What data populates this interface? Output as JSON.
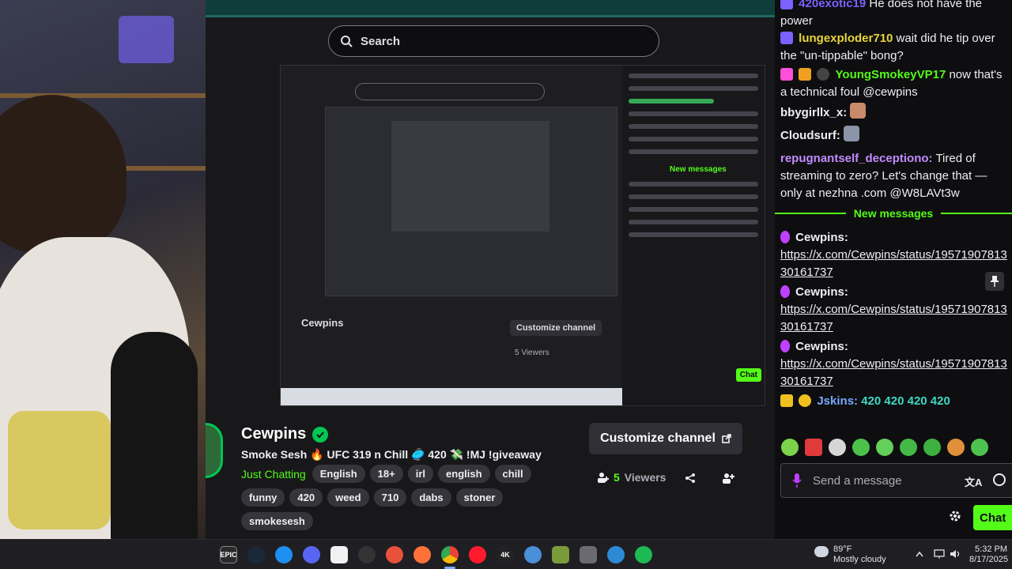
{
  "header": {
    "search_placeholder": "Search"
  },
  "channel": {
    "name": "Cewpins",
    "title": "Smoke Sesh 🔥 UFC 319 n Chill 🥏 420 💸 !MJ !giveaway",
    "category": "Just Chatting",
    "tags_row1": [
      "English",
      "18+",
      "irl",
      "english",
      "chill"
    ],
    "tags_row2": [
      "funny",
      "420",
      "weed",
      "710",
      "dabs",
      "stoner"
    ],
    "tags_row3": [
      "smokesesh"
    ],
    "customize_label": "Customize channel",
    "viewers_count": "5",
    "viewers_label": "Viewers"
  },
  "chat": {
    "messages": [
      {
        "user": "420exotic19",
        "user_color": "#7b61ff",
        "text": "He does not have the power"
      },
      {
        "user": "lungexploder710",
        "user_color": "#e8d53a",
        "text": "wait did he tip over the \"un-tippable\" bong?"
      },
      {
        "user": "YoungSmokeyVP17",
        "user_color": "#53fc18",
        "text": "now that's a technical foul @cewpins"
      },
      {
        "user": "bbygirllx_x:",
        "user_color": "#efeff1",
        "text": ""
      },
      {
        "user": "Cloudsurf:",
        "user_color": "#efeff1",
        "text": ""
      },
      {
        "user": "repugnantself_deceptiono",
        "user_color": "#c38bff",
        "text": "Tired of streaming to zero? Let's change that — only at nezhna .com @W8LAVt3w"
      }
    ],
    "divider_label": "New messages",
    "link_messages": [
      {
        "user": "Cewpins:",
        "user_color": "#efeff1",
        "link": "https://x.com/Cewpins/status/1957190781330161737"
      },
      {
        "user": "Cewpins:",
        "user_color": "#efeff1",
        "link": "https://x.com/Cewpins/status/1957190781330161737"
      },
      {
        "user": "Cewpins:",
        "user_color": "#efeff1",
        "link": "https://x.com/Cewpins/status/1957190781330161737"
      }
    ],
    "emote_user": "Jskins:",
    "emote_user_color": "#7aa7ff",
    "emote_text": "420 420 420 420",
    "input_placeholder": "Send a message",
    "chat_button": "Chat"
  },
  "nested_preview": {
    "channel_name": "Cewpins",
    "customize_label": "Customize channel",
    "viewers_text": "5 Viewers",
    "divider_label": "New messages",
    "chat_button": "Chat"
  },
  "taskbar": {
    "weather_temp": "89°F",
    "weather_desc": "Mostly cloudy",
    "time": "5:32 PM",
    "date": "8/17/2025",
    "icons": [
      "epic-games",
      "steam",
      "app-store",
      "discord",
      "capcut",
      "github",
      "revolut",
      "firefox",
      "chrome",
      "opera",
      "4k-downloader",
      "vpn",
      "minecraft",
      "camera",
      "edge",
      "spotify"
    ]
  },
  "colors": {
    "accent": "#53fc18",
    "background": "#0e0e10",
    "surface": "#18181b"
  }
}
